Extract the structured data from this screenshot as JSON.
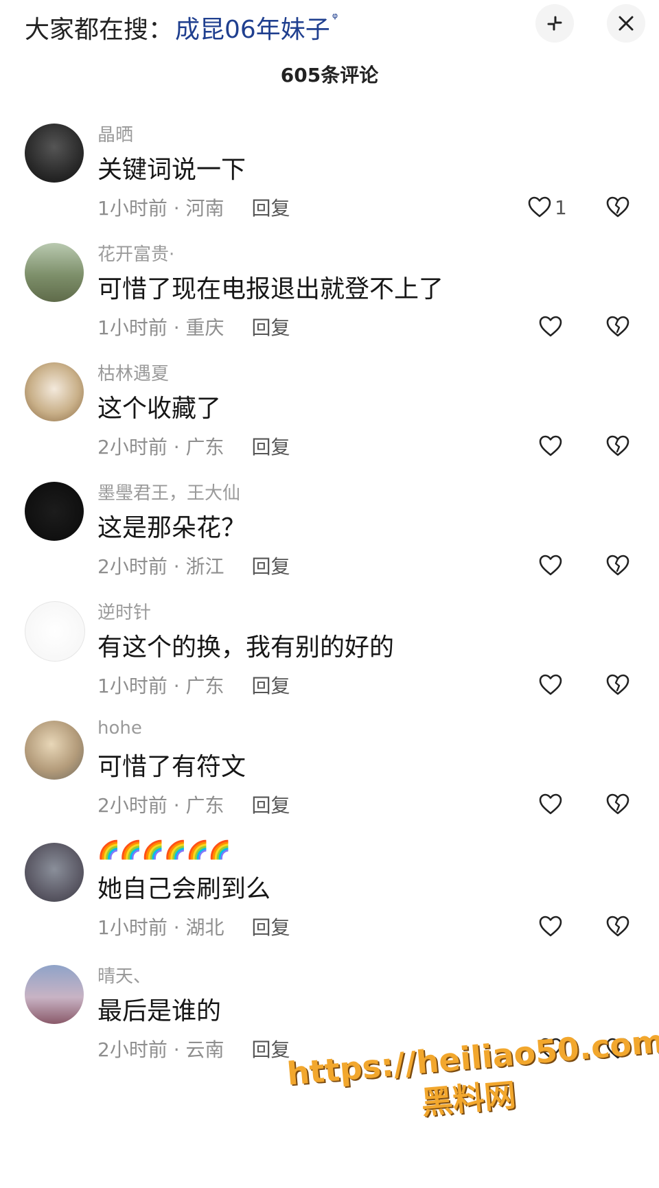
{
  "header": {
    "hot_search_prefix": "大家都在搜：",
    "hot_search_term": "成昆06年妹子",
    "comment_count": "605条评论"
  },
  "comments": [
    {
      "username": "晶晒",
      "text": "关键词说一下",
      "time": "1小时前",
      "location": "河南",
      "reply_label": "回复",
      "like_count": "1"
    },
    {
      "username": "花开富贵·",
      "text": "可惜了现在电报退出就登不上了",
      "time": "1小时前",
      "location": "重庆",
      "reply_label": "回复",
      "like_count": ""
    },
    {
      "username": "枯林遇夏",
      "text": "这个收藏了",
      "time": "2小时前",
      "location": "广东",
      "reply_label": "回复",
      "like_count": ""
    },
    {
      "username": "墨璺君王，王大仙",
      "text": "这是那朵花？",
      "time": "2小时前",
      "location": "浙江",
      "reply_label": "回复",
      "like_count": ""
    },
    {
      "username": "逆时针",
      "text": "有这个的换，我有别的好的",
      "time": "1小时前",
      "location": "广东",
      "reply_label": "回复",
      "like_count": ""
    },
    {
      "username": "hohe",
      "text": "可惜了有符文",
      "time": "2小时前",
      "location": "广东",
      "reply_label": "回复",
      "like_count": ""
    },
    {
      "username": "🌈🌈🌈🌈🌈🌈",
      "text": "她自己会刷到么",
      "time": "1小时前",
      "location": "湖北",
      "reply_label": "回复",
      "like_count": ""
    },
    {
      "username": "晴天、",
      "text": "最后是谁的",
      "time": "2小时前",
      "location": "云南",
      "reply_label": "回复",
      "like_count": ""
    }
  ],
  "watermark": {
    "url": "https://heiliao50.com",
    "name": "黑料网"
  },
  "colors": {
    "hot_term": "#1f3f8f",
    "watermark": "#f2a72d"
  }
}
